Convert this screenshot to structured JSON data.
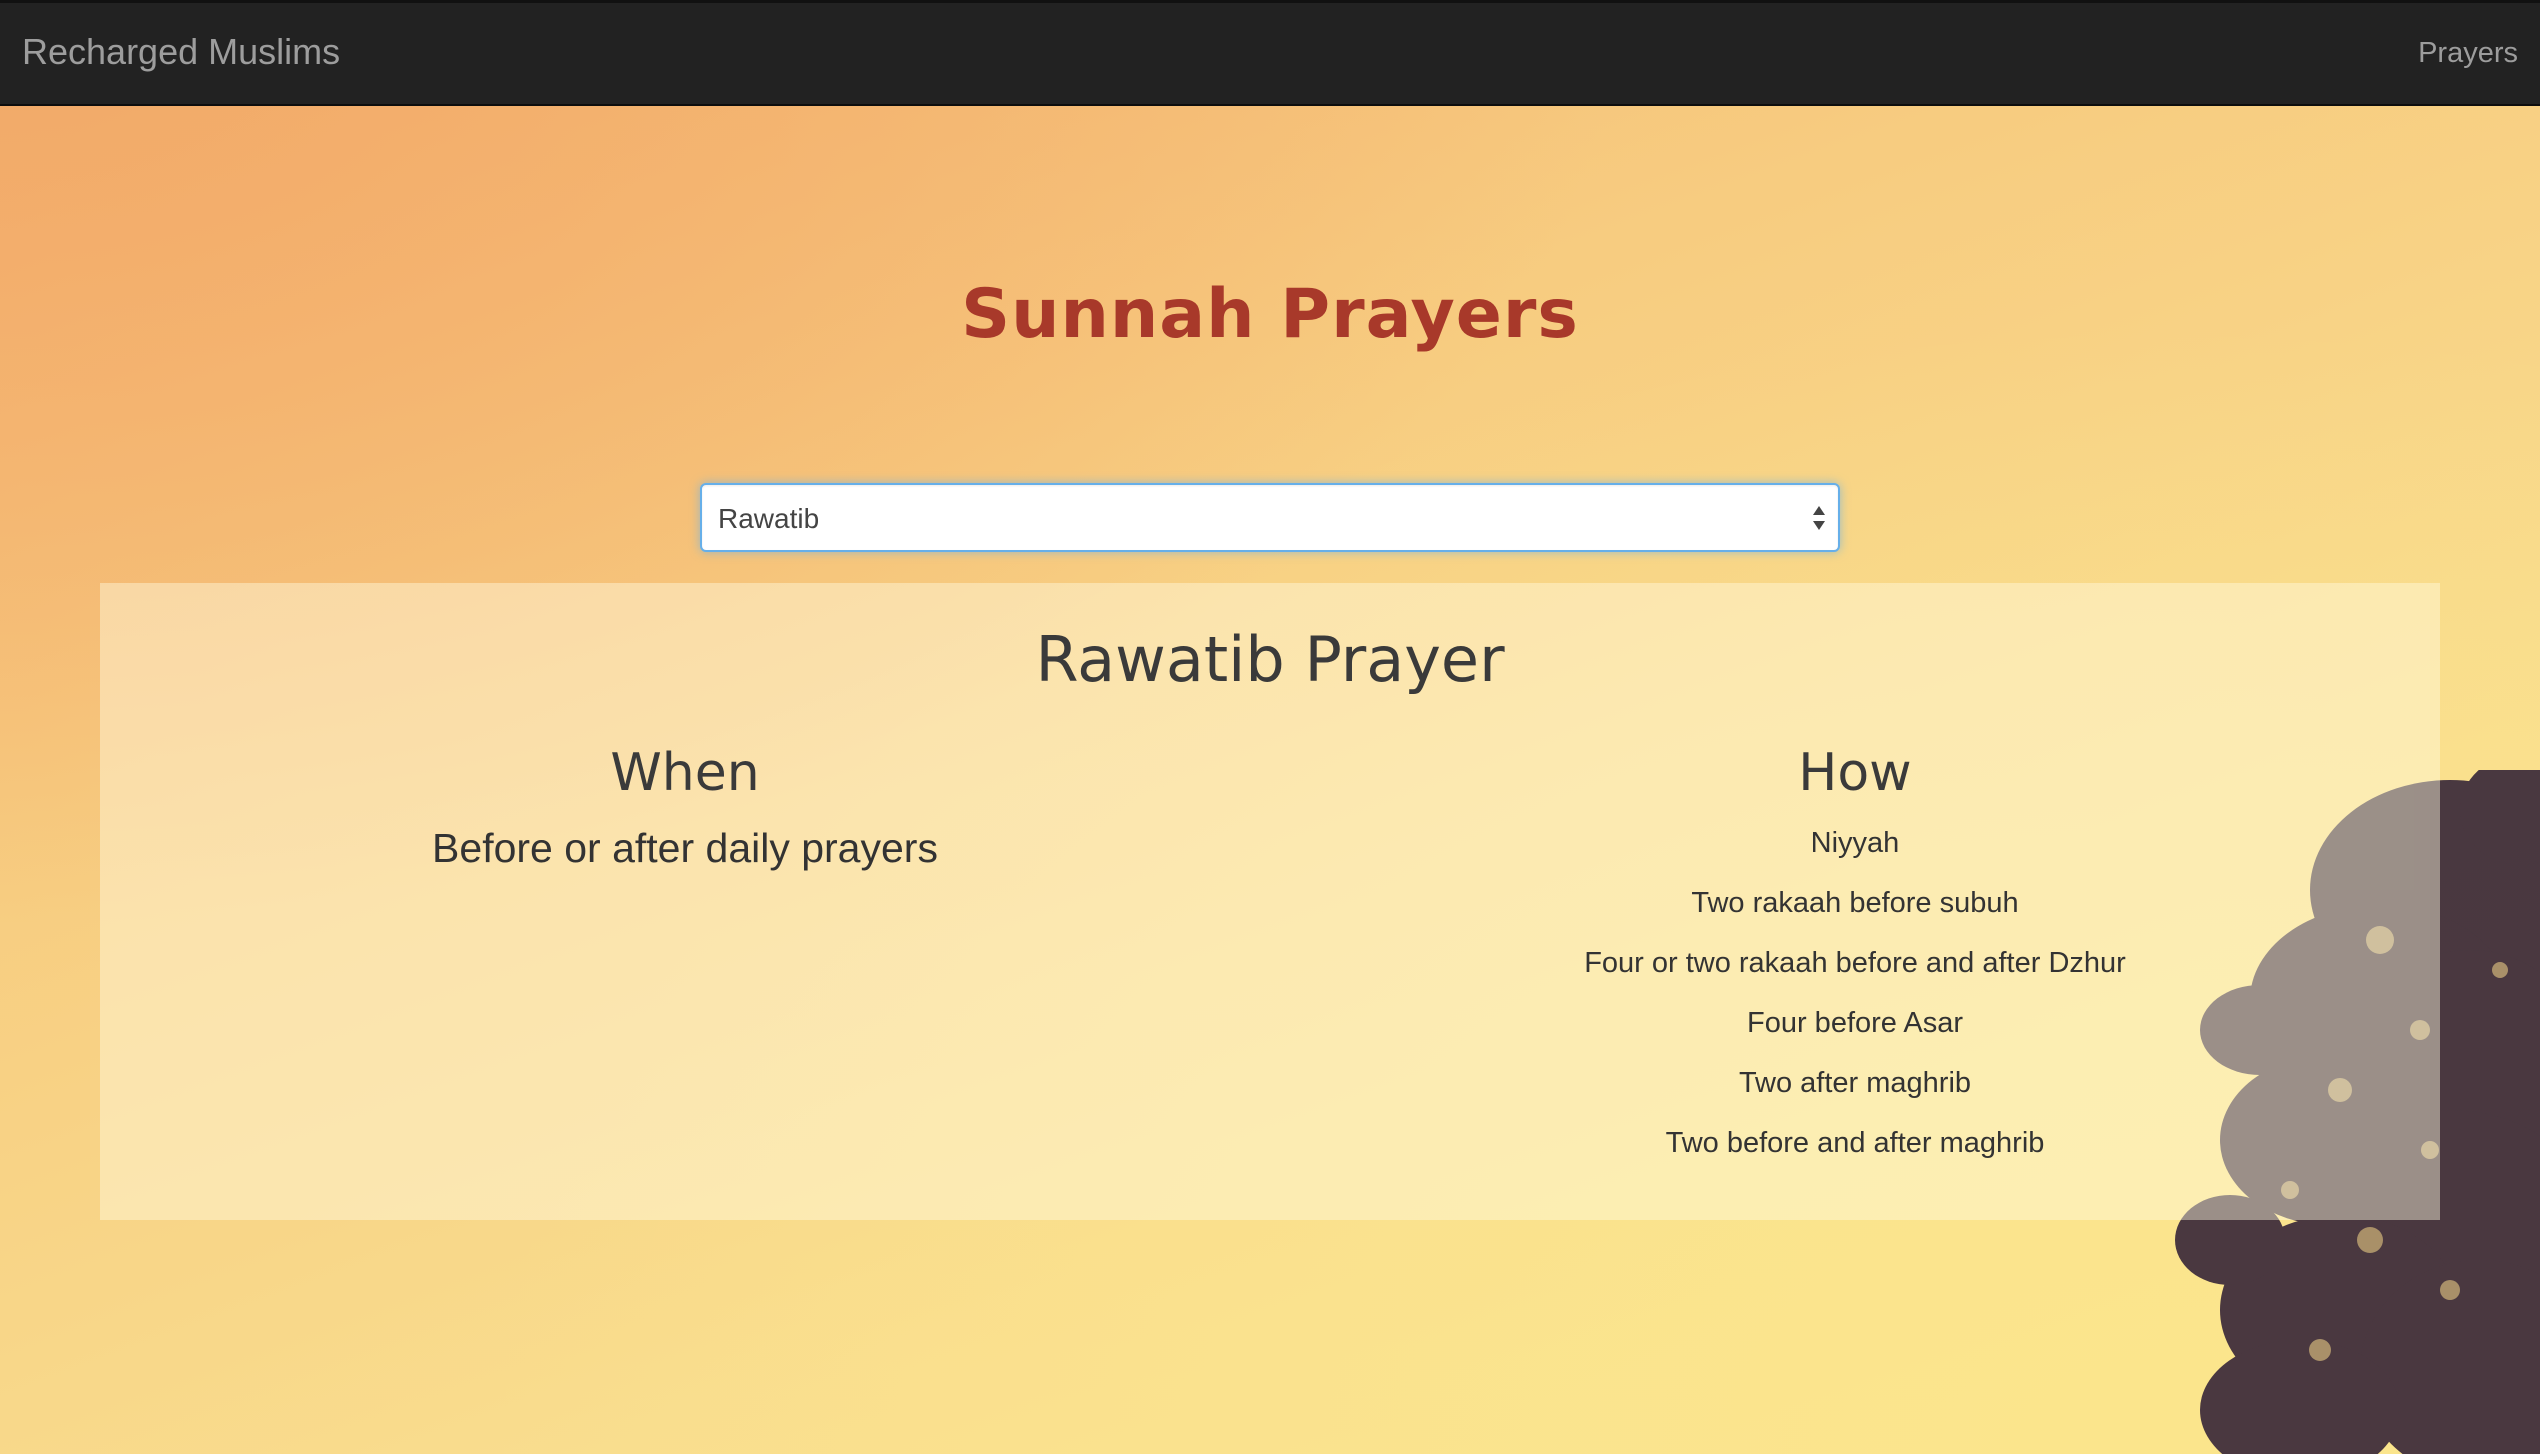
{
  "navbar": {
    "brand": "Recharged Muslims",
    "links": [
      {
        "label": "Prayers"
      }
    ]
  },
  "page": {
    "title": "Sunnah Prayers"
  },
  "prayer_select": {
    "selected": "Rawatib"
  },
  "panel": {
    "title": "Rawatib Prayer",
    "when": {
      "heading": "When",
      "text": "Before or after daily prayers"
    },
    "how": {
      "heading": "How",
      "steps": [
        "Niyyah",
        "Two rakaah before subuh",
        "Four or two rakaah before and after Dzhur",
        "Four before Asar",
        "Two after maghrib",
        "Two before and after maghrib"
      ]
    }
  },
  "colors": {
    "title": "#a8392a",
    "navbar": "#222222",
    "focus_border": "#66afe9"
  },
  "icons": {
    "select_arrows": "updown-arrows-icon",
    "background_tree": "tree-silhouette"
  }
}
